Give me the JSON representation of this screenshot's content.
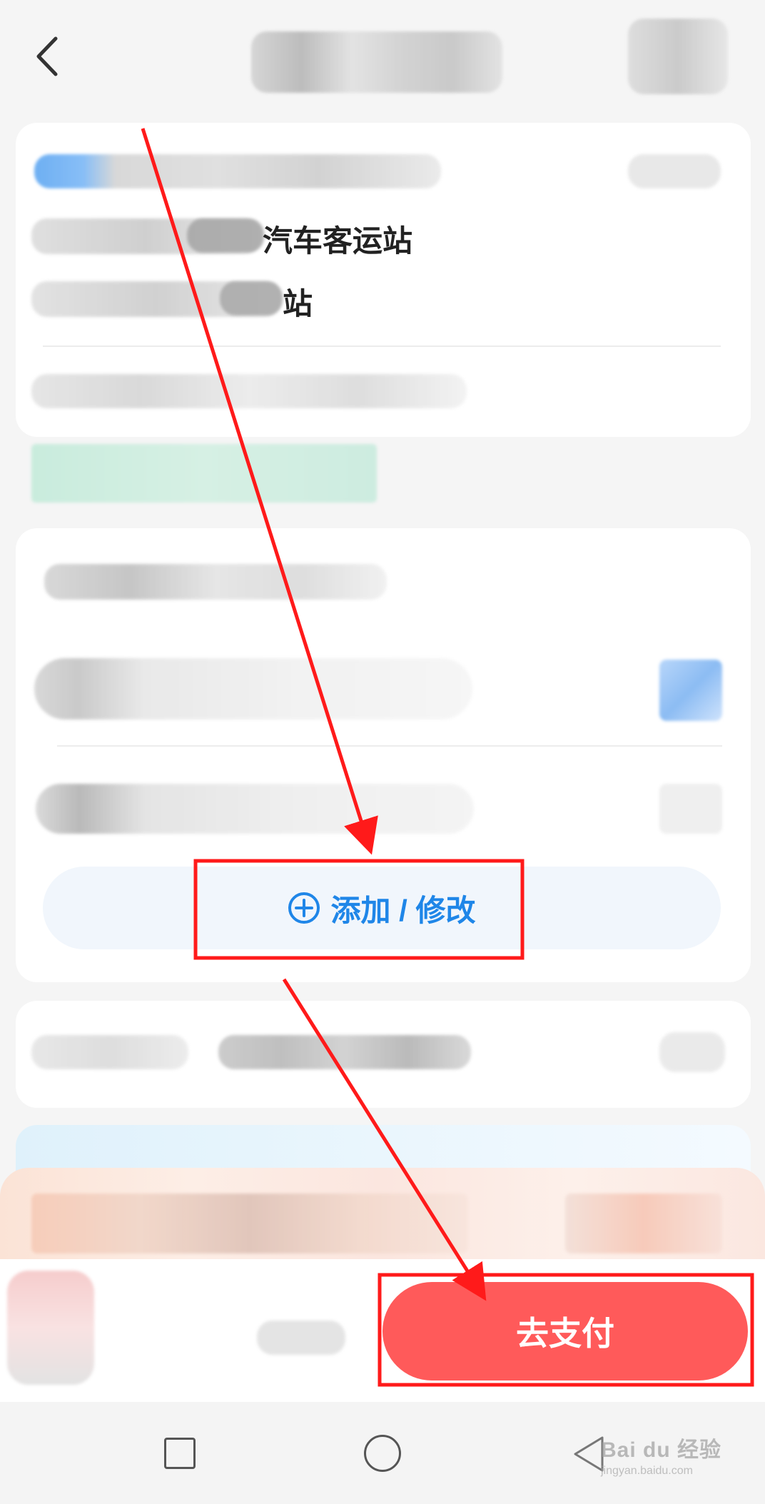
{
  "header": {
    "back_icon": "chevron-left-icon"
  },
  "trip": {
    "departure_station_suffix": "汽车客运站",
    "arrival_station_suffix": "站"
  },
  "passengers": {
    "add_modify_label": "添加 / 修改",
    "add_icon": "plus-circle-icon"
  },
  "footer": {
    "pay_button_label": "去支付"
  },
  "annotation_color": "#ff1a1a",
  "accent_color": "#1f86e8",
  "pay_color": "#ff5a5a",
  "system_nav": {
    "icons": [
      "recent-apps-icon",
      "home-icon",
      "back-triangle-icon"
    ]
  },
  "watermark": {
    "brand": "Bai du 经验",
    "url": "jingyan.baidu.com"
  }
}
